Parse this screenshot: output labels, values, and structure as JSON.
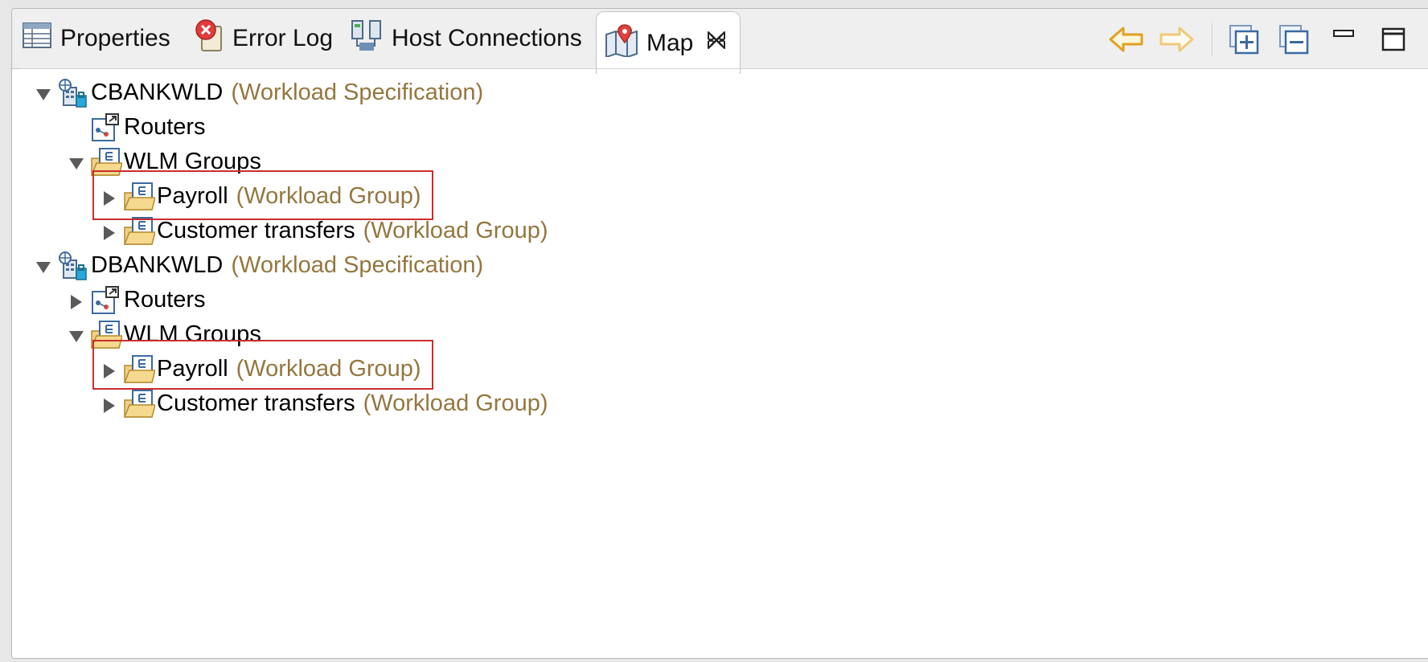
{
  "tabs": [
    {
      "label": "Properties",
      "icon": "properties-icon"
    },
    {
      "label": "Error Log",
      "icon": "error-log-icon"
    },
    {
      "label": "Host Connections",
      "icon": "host-connections-icon"
    },
    {
      "label": "Map",
      "icon": "map-icon",
      "active": true
    }
  ],
  "toolbar": {
    "back": "back-arrow-icon",
    "forward": "forward-arrow-icon",
    "expand_all": "expand-all-icon",
    "collapse_all": "collapse-all-icon",
    "minimize": "minimize-icon",
    "maximize": "maximize-icon"
  },
  "tree": {
    "nodes": [
      {
        "name": "CBANKWLD",
        "type": "(Workload Specification)",
        "state": "expanded"
      },
      {
        "name": "Routers",
        "type": "",
        "state": "leaf"
      },
      {
        "name": "WLM Groups",
        "type": "",
        "state": "expanded"
      },
      {
        "name": "Payroll",
        "type": "(Workload Group)",
        "state": "collapsed",
        "highlighted": true
      },
      {
        "name": "Customer transfers",
        "type": "(Workload Group)",
        "state": "collapsed"
      },
      {
        "name": "DBANKWLD",
        "type": "(Workload Specification)",
        "state": "expanded"
      },
      {
        "name": "Routers",
        "type": "",
        "state": "collapsed"
      },
      {
        "name": "WLM Groups",
        "type": "",
        "state": "expanded"
      },
      {
        "name": "Payroll",
        "type": "(Workload Group)",
        "state": "collapsed",
        "highlighted": true
      },
      {
        "name": "Customer transfers",
        "type": "(Workload Group)",
        "state": "collapsed"
      }
    ]
  },
  "colors": {
    "type_text": "#94773f",
    "highlight_border": "#cc2d2d",
    "nav_arrow": "#e0a020"
  }
}
